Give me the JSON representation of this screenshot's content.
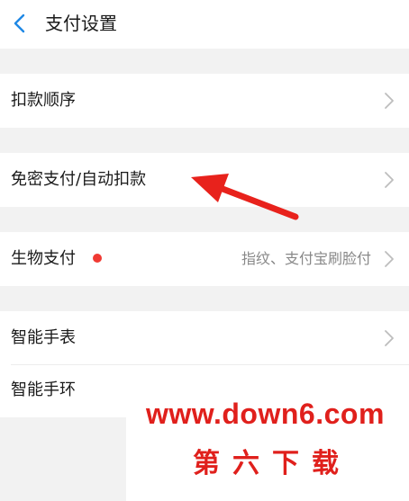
{
  "header": {
    "title": "支付设置",
    "back_icon": "chevron-left-icon"
  },
  "rows": [
    {
      "label": "扣款顺序",
      "subtext": "",
      "has_dot": false,
      "has_chevron": true
    },
    {
      "label": "免密支付/自动扣款",
      "subtext": "",
      "has_dot": false,
      "has_chevron": true
    },
    {
      "label": "生物支付",
      "subtext": "指纹、支付宝刷脸付",
      "has_dot": true,
      "has_chevron": true
    },
    {
      "label": "智能手表",
      "subtext": "",
      "has_dot": false,
      "has_chevron": true
    },
    {
      "label": "智能手环",
      "subtext": "",
      "has_dot": false,
      "has_chevron": false
    }
  ],
  "annotation": {
    "arrow_icon": "red-arrow-icon",
    "color": "#e8221c"
  },
  "watermark": {
    "url": "www.down6.com",
    "chinese": "第六下载",
    "color": "#e0201c"
  },
  "colors": {
    "background": "#f2f2f2",
    "surface": "#ffffff",
    "accent_blue": "#1e88e5",
    "text_primary": "#1a1a1a",
    "text_secondary": "#888888",
    "red_dot": "#f03a33"
  }
}
